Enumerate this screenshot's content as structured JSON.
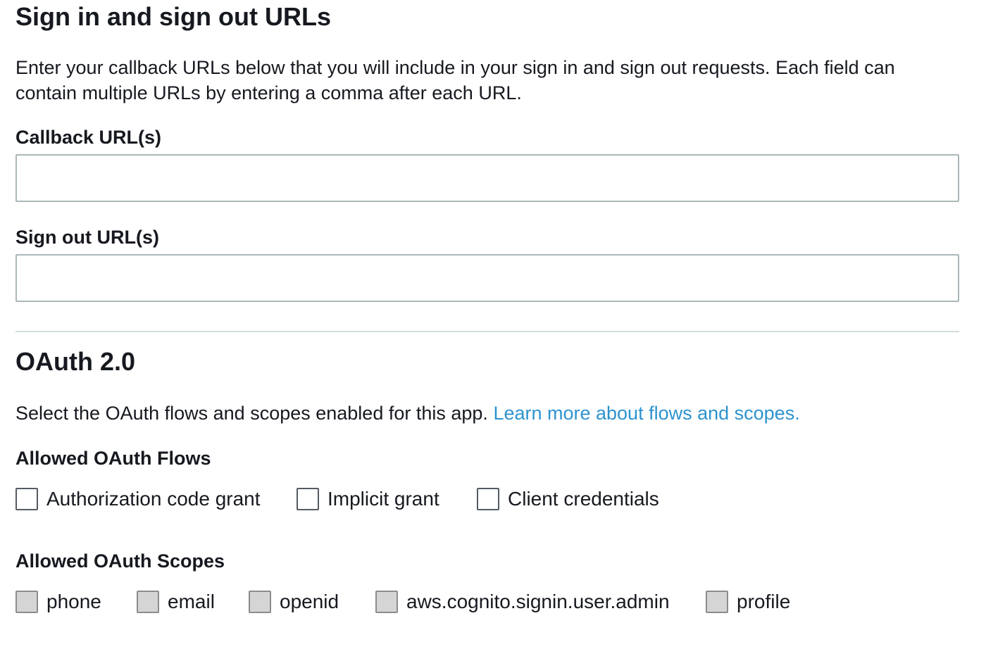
{
  "signin_section": {
    "title": "Sign in and sign out URLs",
    "description": "Enter your callback URLs below that you will include in your sign in and sign out requests. Each field can contain multiple URLs by entering a comma after each URL.",
    "callback": {
      "label": "Callback URL(s)",
      "value": ""
    },
    "signout": {
      "label": "Sign out URL(s)",
      "value": ""
    }
  },
  "oauth_section": {
    "title": "OAuth 2.0",
    "description": "Select the OAuth flows and scopes enabled for this app.",
    "learn_more_link": "Learn more about flows and scopes.",
    "flows_label": "Allowed OAuth Flows",
    "flows": [
      {
        "label": "Authorization code grant",
        "checked": false
      },
      {
        "label": "Implicit grant",
        "checked": false
      },
      {
        "label": "Client credentials",
        "checked": false
      }
    ],
    "scopes_label": "Allowed OAuth Scopes",
    "scopes": [
      {
        "label": "phone",
        "checked": false,
        "disabled": true
      },
      {
        "label": "email",
        "checked": false,
        "disabled": true
      },
      {
        "label": "openid",
        "checked": false,
        "disabled": true
      },
      {
        "label": "aws.cognito.signin.user.admin",
        "checked": false,
        "disabled": true
      },
      {
        "label": "profile",
        "checked": false,
        "disabled": true
      }
    ]
  },
  "colors": {
    "text": "#16191f",
    "link": "#2d93ce",
    "input_border": "#aab7b8",
    "divider": "#d5dbdb",
    "checkbox_border": "#545b64",
    "disabled_checkbox_fill": "#d5d5d5"
  }
}
